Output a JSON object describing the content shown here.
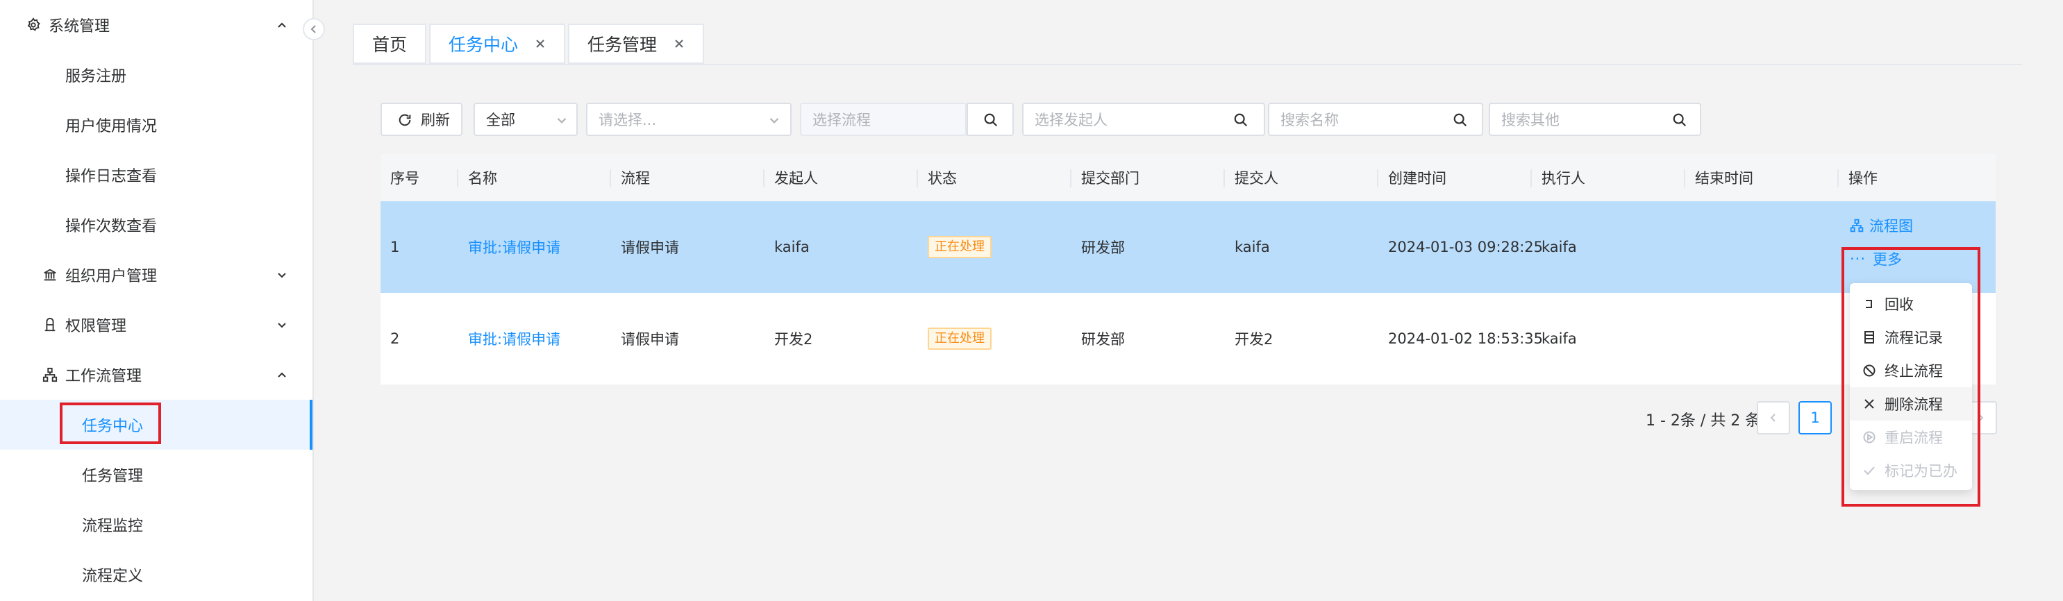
{
  "sidebar": {
    "items": [
      {
        "label": "系统管理"
      },
      {
        "label": "服务注册"
      },
      {
        "label": "用户使用情况"
      },
      {
        "label": "操作日志查看"
      },
      {
        "label": "操作次数查看"
      },
      {
        "label": "组织用户管理"
      },
      {
        "label": "权限管理"
      },
      {
        "label": "工作流管理"
      },
      {
        "label": "任务中心"
      },
      {
        "label": "任务管理"
      },
      {
        "label": "流程监控"
      },
      {
        "label": "流程定义"
      }
    ]
  },
  "tabs": [
    {
      "label": "首页"
    },
    {
      "label": "任务中心"
    },
    {
      "label": "任务管理"
    }
  ],
  "toolbar": {
    "refresh_label": "刷新",
    "status_select": "全部",
    "select_placeholder": "请选择...",
    "process_placeholder": "选择流程",
    "initiator_placeholder": "选择发起人",
    "name_placeholder": "搜索名称",
    "other_placeholder": "搜索其他"
  },
  "table": {
    "columns": [
      "序号",
      "名称",
      "流程",
      "发起人",
      "状态",
      "提交部门",
      "提交人",
      "创建时间",
      "执行人",
      "结束时间",
      "操作"
    ],
    "rows": [
      {
        "index": "1",
        "name": "审批:请假申请",
        "process": "请假申请",
        "initiator": "kaifa",
        "status": "正在处理",
        "dept": "研发部",
        "submitter": "kaifa",
        "created": "2024-01-03 09:28:25",
        "executor": "kaifa",
        "ended": ""
      },
      {
        "index": "2",
        "name": "审批:请假申请",
        "process": "请假申请",
        "initiator": "开发2",
        "status": "正在处理",
        "dept": "研发部",
        "submitter": "开发2",
        "created": "2024-01-02 18:53:35",
        "executor": "kaifa",
        "ended": ""
      }
    ],
    "actions": {
      "diagram": "流程图",
      "more": "更多"
    }
  },
  "dropdown": {
    "items": [
      {
        "label": "回收",
        "icon": "recall-icon",
        "enabled": true
      },
      {
        "label": "流程记录",
        "icon": "record-icon",
        "enabled": true
      },
      {
        "label": "终止流程",
        "icon": "stop-icon",
        "enabled": true
      },
      {
        "label": "删除流程",
        "icon": "close-icon",
        "enabled": true
      },
      {
        "label": "重启流程",
        "icon": "restart-icon",
        "enabled": false
      },
      {
        "label": "标记为已办",
        "icon": "check-icon",
        "enabled": false
      }
    ]
  },
  "pagination": {
    "total_text": "1 - 2条 / 共 2 条",
    "current_page": "1"
  },
  "colors": {
    "accent": "#1890ff",
    "selected_row": "#b9ddfb",
    "highlight_box": "#e0202a",
    "tag_text": "#fa8c16"
  }
}
